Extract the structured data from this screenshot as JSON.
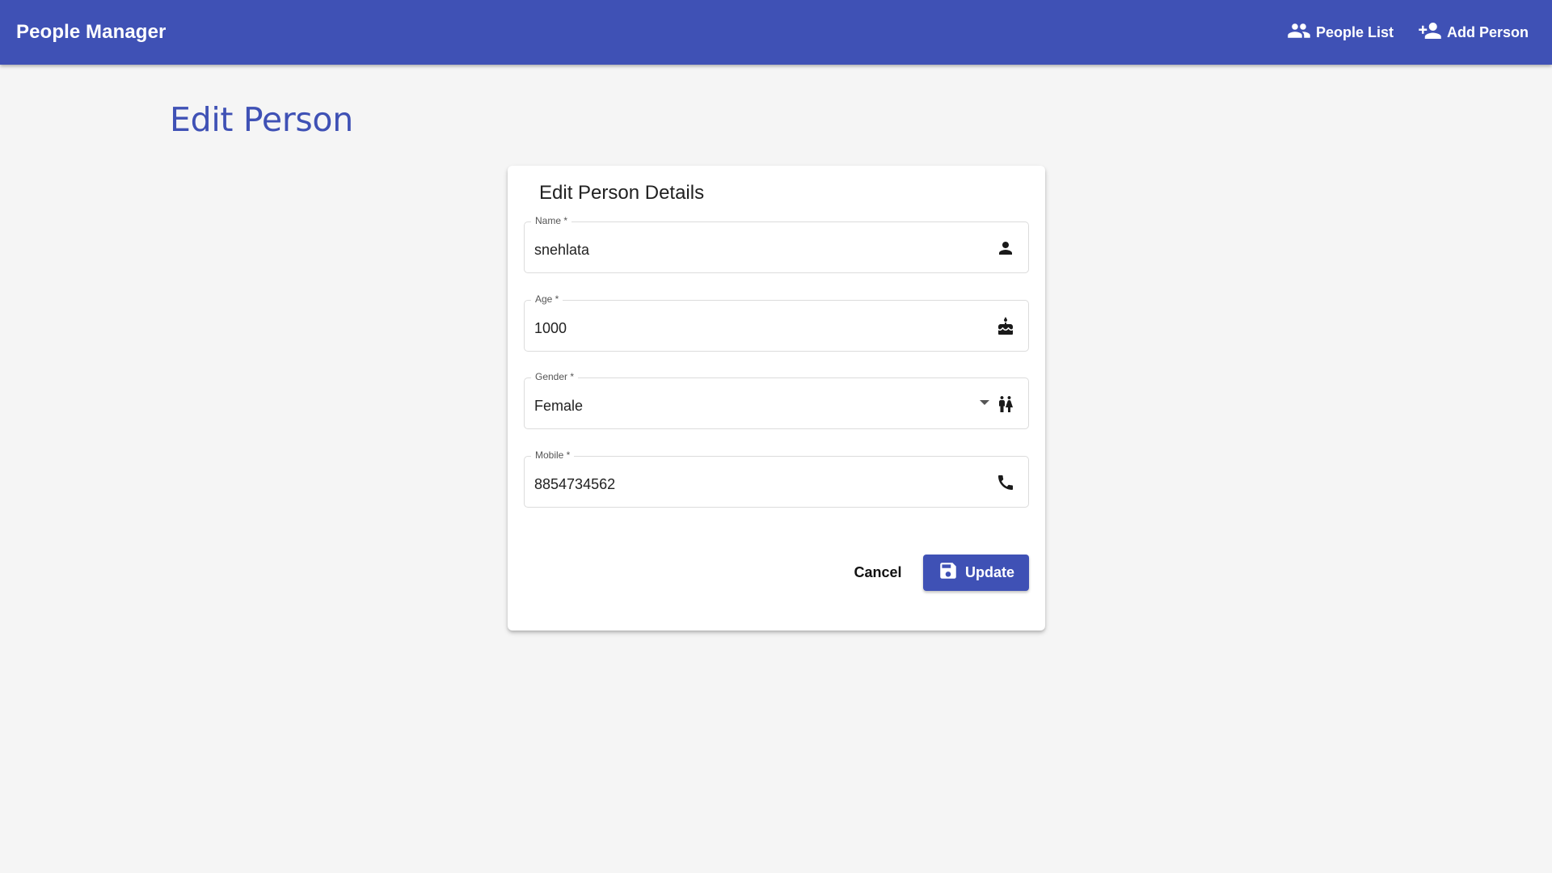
{
  "app": {
    "title": "People Manager",
    "accent_color": "#3f51b5",
    "background_color": "#f5f5f5"
  },
  "nav": {
    "people_list": {
      "label": "People List",
      "icon": "people-icon"
    },
    "add_person": {
      "label": "Add Person",
      "icon": "person-add-icon"
    }
  },
  "page": {
    "title": "Edit Person"
  },
  "form": {
    "title": "Edit Person Details",
    "fields": {
      "name": {
        "label": "Name *",
        "value": "snehlata",
        "icon": "person-icon"
      },
      "age": {
        "label": "Age *",
        "value": "1000",
        "icon": "cake-icon"
      },
      "gender": {
        "label": "Gender *",
        "value": "Female",
        "icon": "wc-icon"
      },
      "mobile": {
        "label": "Mobile *",
        "value": "8854734562",
        "icon": "phone-icon"
      }
    },
    "actions": {
      "cancel_label": "Cancel",
      "update_label": "Update",
      "update_icon": "save-icon"
    }
  }
}
